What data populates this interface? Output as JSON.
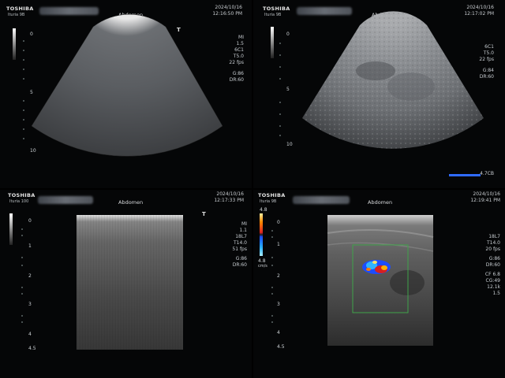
{
  "panels": [
    {
      "brand": "TOSHIBA",
      "sub": "Ituria 9B",
      "exam": "Abdomen",
      "date": "2024/10/16",
      "time": "12:16:50 PM",
      "depth_ticks": [
        "0",
        "5",
        "10"
      ],
      "params": [
        "MI",
        "1.5",
        "6C1",
        "T5.0",
        "22 fps",
        "G:86",
        "DR:60"
      ]
    },
    {
      "brand": "TOSHIBA",
      "sub": "Ituria 9B",
      "exam": "Abdomen",
      "date": "2024/10/16",
      "time": "12:17:02 PM",
      "depth_ticks": [
        "0",
        "5",
        "10"
      ],
      "params": [
        "6C1",
        "T5.0",
        "22 fps",
        "G:84",
        "DR:60"
      ],
      "scale_label": "4.7CB"
    },
    {
      "brand": "TOSHIBA",
      "sub": "Ituria 100",
      "exam": "Abdomen",
      "date": "2024/10/16",
      "time": "12:17:33 PM",
      "depth_ticks": [
        "0",
        "1",
        "2",
        "3",
        "4",
        "4.5"
      ],
      "params": [
        "MI",
        "1.1",
        "18L7",
        "T14.0",
        "51 fps",
        "G:86",
        "DR:60"
      ]
    },
    {
      "brand": "TOSHIBA",
      "sub": "Ituria 9B",
      "exam": "Abdomen",
      "date": "2024/10/16",
      "time": "12:19:41 PM",
      "depth_ticks": [
        "0",
        "1",
        "2",
        "3",
        "4",
        "4.5"
      ],
      "params": [
        "18L7",
        "T14.0",
        "20 fps",
        "G:86",
        "DR:60",
        "CF 6.8",
        "CG:49",
        "12.1k",
        "1.5"
      ],
      "color_scale_top": "4.8",
      "color_scale_bottom": "4.8",
      "color_scale_unit": "cm/s"
    }
  ],
  "colors": {
    "background": "#000000",
    "doppler_box": "#3fa34a",
    "scale_bar": "#2f6bff"
  }
}
